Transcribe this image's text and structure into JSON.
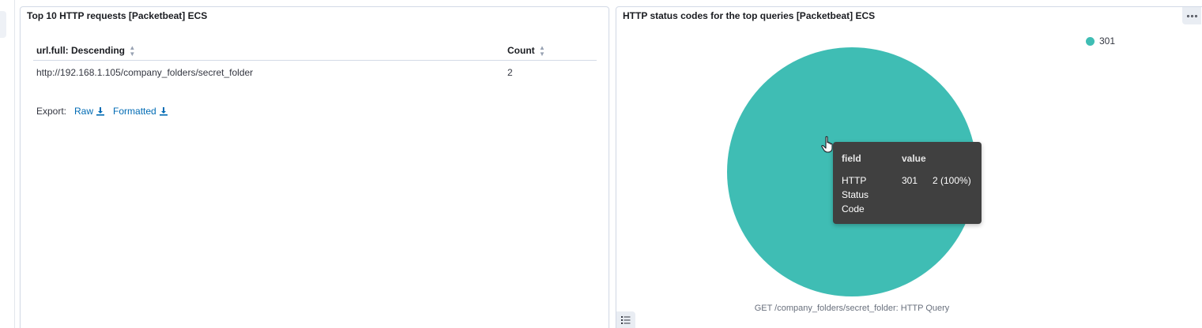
{
  "left_panel": {
    "title": "Top 10 HTTP requests [Packetbeat] ECS",
    "columns": [
      {
        "label": "url.full: Descending"
      },
      {
        "label": "Count"
      }
    ],
    "rows": [
      {
        "url": "http://192.168.1.105/company_folders/secret_folder",
        "count": "2"
      }
    ],
    "export": {
      "label": "Export:",
      "raw": "Raw",
      "formatted": "Formatted"
    }
  },
  "right_panel": {
    "title": "HTTP status codes for the top queries [Packetbeat] ECS",
    "caption": "GET /company_folders/secret_folder: HTTP Query",
    "legend": [
      {
        "label": "301",
        "color": "#3fbdb4"
      }
    ],
    "tooltip": {
      "header_field": "field",
      "header_value": "value",
      "field_line1": "HTTP",
      "field_line2": "Status",
      "field_line3": "Code",
      "value": "301",
      "count": "2 (100%)"
    }
  },
  "chart_data": {
    "type": "pie",
    "categories": [
      "301"
    ],
    "values": [
      2
    ]
  }
}
